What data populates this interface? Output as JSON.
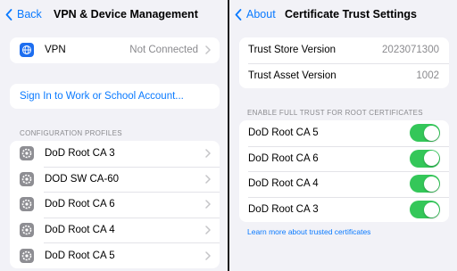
{
  "left": {
    "back_label": "Back",
    "title": "VPN & Device Management",
    "vpn": {
      "label": "VPN",
      "status": "Not Connected",
      "icon": "vpn-globe-icon"
    },
    "sign_in": "Sign In to Work or School Account...",
    "profiles_header": "CONFIGURATION PROFILES",
    "profiles": [
      {
        "name": "DoD Root CA 3"
      },
      {
        "name": "DOD SW CA-60"
      },
      {
        "name": "DoD Root CA 6"
      },
      {
        "name": "DoD Root CA 4"
      },
      {
        "name": "DoD Root CA 5"
      }
    ]
  },
  "right": {
    "back_label": "About",
    "title": "Certificate Trust Settings",
    "trust_store": {
      "label": "Trust Store Version",
      "value": "2023071300"
    },
    "trust_asset": {
      "label": "Trust Asset Version",
      "value": "1002"
    },
    "trust_header": "ENABLE FULL TRUST FOR ROOT CERTIFICATES",
    "certs": [
      {
        "name": "DoD Root CA 5",
        "enabled": true
      },
      {
        "name": "DoD Root CA 6",
        "enabled": true
      },
      {
        "name": "DoD Root CA 4",
        "enabled": true
      },
      {
        "name": "DoD Root CA 3",
        "enabled": true
      }
    ],
    "learn_more": "Learn more about trusted certificates"
  },
  "colors": {
    "accent": "#0a7aff",
    "toggle_on": "#34c759",
    "background": "#f2f2f7"
  }
}
